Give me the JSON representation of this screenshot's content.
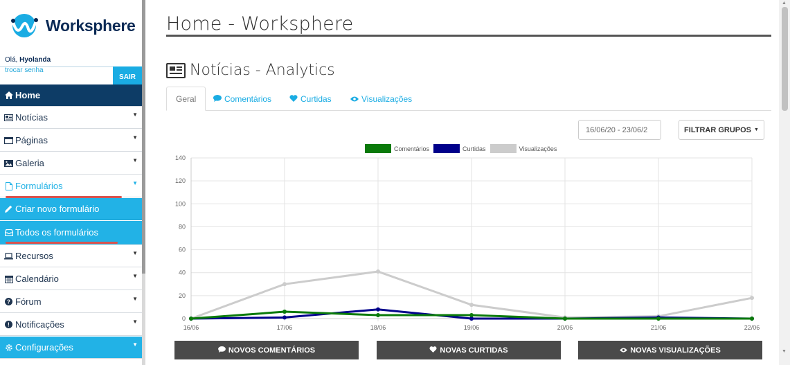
{
  "sidebar": {
    "logo_text": "Worksphere",
    "greeting_prefix": "Olá, ",
    "user_name": "Hyolanda",
    "change_password": "trocar senha",
    "logout": "SAIR",
    "items": [
      {
        "label": "Home",
        "icon": "home-icon"
      },
      {
        "label": "Notícias",
        "icon": "newspaper-icon"
      },
      {
        "label": "Páginas",
        "icon": "window-icon"
      },
      {
        "label": "Galeria",
        "icon": "picture-icon"
      },
      {
        "label": "Formulários",
        "icon": "file-icon"
      },
      {
        "label": "Criar novo formulário",
        "icon": "pencil-icon"
      },
      {
        "label": "Todos os formulários",
        "icon": "inbox-icon"
      },
      {
        "label": "Recursos",
        "icon": "laptop-icon"
      },
      {
        "label": "Calendário",
        "icon": "calendar-icon"
      },
      {
        "label": "Fórum",
        "icon": "question-icon"
      },
      {
        "label": "Notificações",
        "icon": "exclamation-icon"
      },
      {
        "label": "Configurações",
        "icon": "gear-icon"
      }
    ]
  },
  "main": {
    "page_title": "Home - Worksphere",
    "section_title": "Notícias - Analytics",
    "tabs": [
      {
        "label": "Geral"
      },
      {
        "label": "Comentários"
      },
      {
        "label": "Curtidas"
      },
      {
        "label": "Visualizações"
      }
    ],
    "date_range": "16/06/20 - 23/06/2",
    "filter_button": "FILTRAR GRUPOS",
    "buttons": {
      "comments": "NOVOS COMENTÁRIOS",
      "likes": "NOVAS CURTIDAS",
      "views": "NOVAS VISUALIZAÇÕES"
    }
  },
  "chart_data": {
    "type": "line",
    "categories": [
      "16/06",
      "17/06",
      "18/06",
      "19/06",
      "20/06",
      "21/06",
      "22/06"
    ],
    "ylim": [
      0,
      140
    ],
    "yticks": [
      0,
      20,
      40,
      60,
      80,
      100,
      120,
      140
    ],
    "grid": true,
    "legend_position": "top-center",
    "series": [
      {
        "name": "Comentários",
        "color": "#0a7a0a",
        "values": [
          0,
          6,
          3,
          3,
          0,
          0,
          0
        ]
      },
      {
        "name": "Curtidas",
        "color": "#00008b",
        "values": [
          0,
          1,
          8,
          0,
          0,
          1,
          0
        ]
      },
      {
        "name": "Visualizações",
        "color": "#cccccc",
        "values": [
          0,
          30,
          41,
          12,
          1,
          2,
          18
        ]
      }
    ]
  }
}
